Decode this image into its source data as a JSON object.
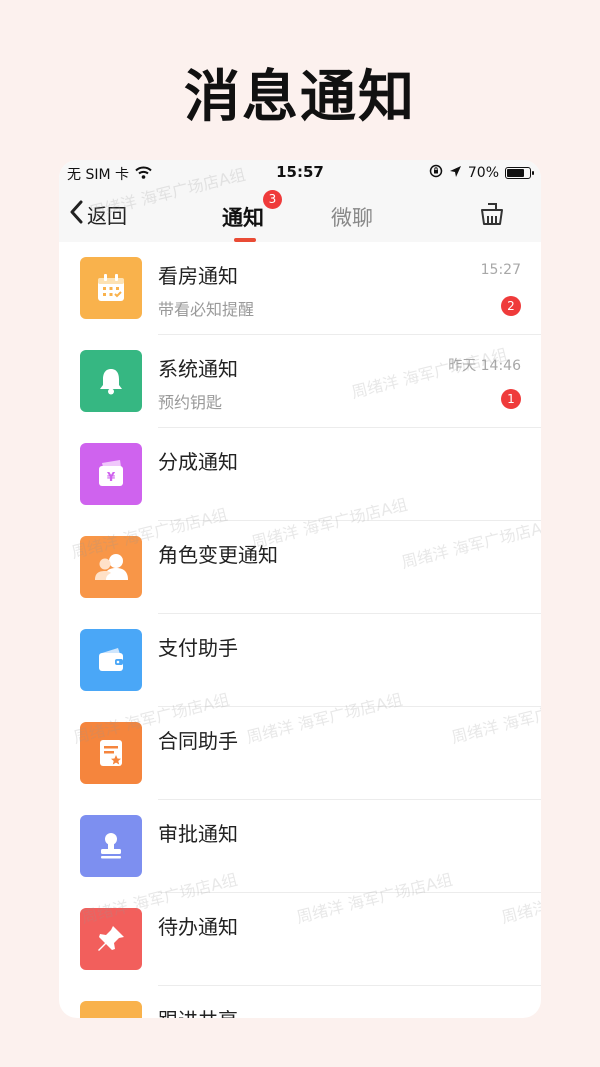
{
  "promo": {
    "title": "消息通知"
  },
  "status_bar": {
    "carrier": "无 SIM 卡",
    "time": "15:57",
    "battery": "70%"
  },
  "nav": {
    "back_label": "返回",
    "tab_notice": "通知",
    "tab_notice_badge": "3",
    "tab_chat": "微聊"
  },
  "watermark": {
    "text": "周绪洋 海军广场店A组"
  },
  "items": [
    {
      "title": "看房通知",
      "sub": "带看必知提醒",
      "time": "15:27",
      "count": "2",
      "icon": "calendar-icon",
      "color": "#f9b24c"
    },
    {
      "title": "系统通知",
      "sub": "预约钥匙",
      "time": "昨天 14:46",
      "count": "1",
      "icon": "bell-icon",
      "color": "#36b782"
    },
    {
      "title": "分成通知",
      "sub": "",
      "time": "",
      "count": "",
      "icon": "wallet-yen-icon",
      "color": "#cf63ee"
    },
    {
      "title": "角色变更通知",
      "sub": "",
      "time": "",
      "count": "",
      "icon": "users-icon",
      "color": "#f89648"
    },
    {
      "title": "支付助手",
      "sub": "",
      "time": "",
      "count": "",
      "icon": "wallet-icon",
      "color": "#4aa7f7"
    },
    {
      "title": "合同助手",
      "sub": "",
      "time": "",
      "count": "",
      "icon": "contract-icon",
      "color": "#f5853d"
    },
    {
      "title": "审批通知",
      "sub": "",
      "time": "",
      "count": "",
      "icon": "stamp-icon",
      "color": "#7d8ff0"
    },
    {
      "title": "待办通知",
      "sub": "",
      "time": "",
      "count": "",
      "icon": "pin-icon",
      "color": "#f25f5c"
    },
    {
      "title": "跟进共享",
      "sub": "",
      "time": "",
      "count": "",
      "icon": "share-icon",
      "color": "#f9b24c"
    }
  ]
}
